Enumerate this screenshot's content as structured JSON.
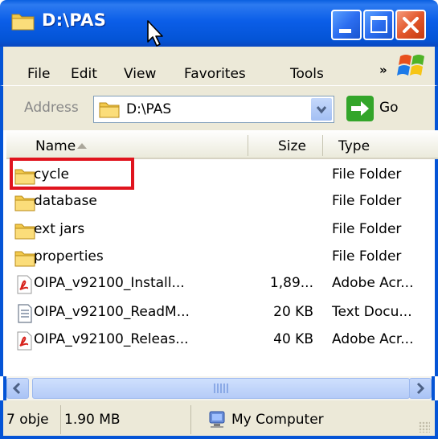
{
  "window": {
    "title": "D:\\PAS",
    "minimize_label": "",
    "maximize_label": "",
    "close_label": ""
  },
  "menu": {
    "items": [
      "File",
      "Edit",
      "View",
      "Favorites",
      "Tools"
    ],
    "overflow": "»"
  },
  "address": {
    "label": "Address",
    "value": "D:\\PAS",
    "go_label": "Go"
  },
  "columns": {
    "name": "Name",
    "size": "Size",
    "type": "Type"
  },
  "files": [
    {
      "icon": "folder-icon",
      "name": "cycle",
      "size": "",
      "type": "File Folder"
    },
    {
      "icon": "folder-icon",
      "name": "database",
      "size": "",
      "type": "File Folder"
    },
    {
      "icon": "folder-icon",
      "name": "ext jars",
      "size": "",
      "type": "File Folder"
    },
    {
      "icon": "folder-icon",
      "name": "properties",
      "size": "",
      "type": "File Folder"
    },
    {
      "icon": "pdf-icon",
      "name": "OIPA_v92100_Install...",
      "size": "1,89...",
      "type": "Adobe Acr..."
    },
    {
      "icon": "text-document-icon",
      "name": "OIPA_v92100_ReadM...",
      "size": "20 KB",
      "type": "Text Docu..."
    },
    {
      "icon": "pdf-icon",
      "name": "OIPA_v92100_Releas...",
      "size": "40 KB",
      "type": "Adobe Acr..."
    }
  ],
  "status": {
    "objects": "7 obje",
    "total_size": "1.90 MB",
    "location": "My Computer"
  },
  "colors": {
    "titlebar": "#0454d6",
    "chrome": "#ece9d8",
    "highlight_box": "#e0141e"
  }
}
